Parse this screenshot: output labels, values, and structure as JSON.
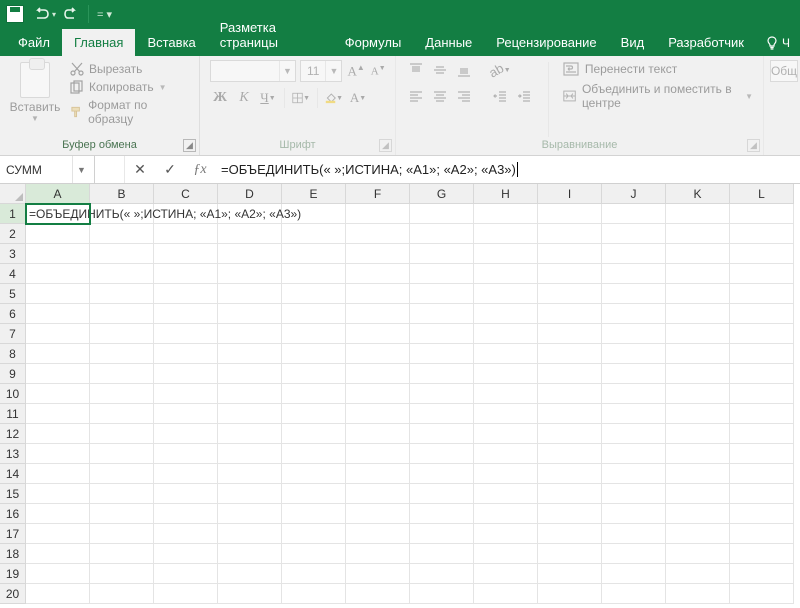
{
  "qat": {
    "save": "save",
    "undo": "undo",
    "redo": "redo"
  },
  "tabs": {
    "file": "Файл",
    "home": "Главная",
    "insert": "Вставка",
    "layout": "Разметка страницы",
    "formulas": "Формулы",
    "data": "Данные",
    "review": "Рецензирование",
    "view": "Вид",
    "developer": "Разработчик",
    "tell_me": "Ч"
  },
  "ribbon": {
    "paste": {
      "label": "Вставить"
    },
    "clipboard": {
      "cut": "Вырезать",
      "copy": "Копировать",
      "painter": "Формат по образцу",
      "title": "Буфер обмена"
    },
    "font": {
      "name": "",
      "size": "11",
      "title": "Шрифт"
    },
    "align": {
      "wrap": "Перенести текст",
      "merge": "Объединить и поместить в центре",
      "title": "Выравнивание"
    },
    "number": {
      "format": "Общ"
    }
  },
  "formula_bar": {
    "name_box": "СУММ",
    "formula": "=ОБЪЕДИНИТЬ(« »;ИСТИНА; «А1»; «А2»; «А3»)"
  },
  "sheet": {
    "columns": [
      "A",
      "B",
      "C",
      "D",
      "E",
      "F",
      "G",
      "H",
      "I",
      "J",
      "K",
      "L"
    ],
    "rows": 20,
    "editing_cell": {
      "row": 1,
      "col": "A"
    },
    "cell_A1": "=ОБЪЕДИНИТЬ(« »;ИСТИНА; «А1»; «А2»; «А3»)"
  }
}
